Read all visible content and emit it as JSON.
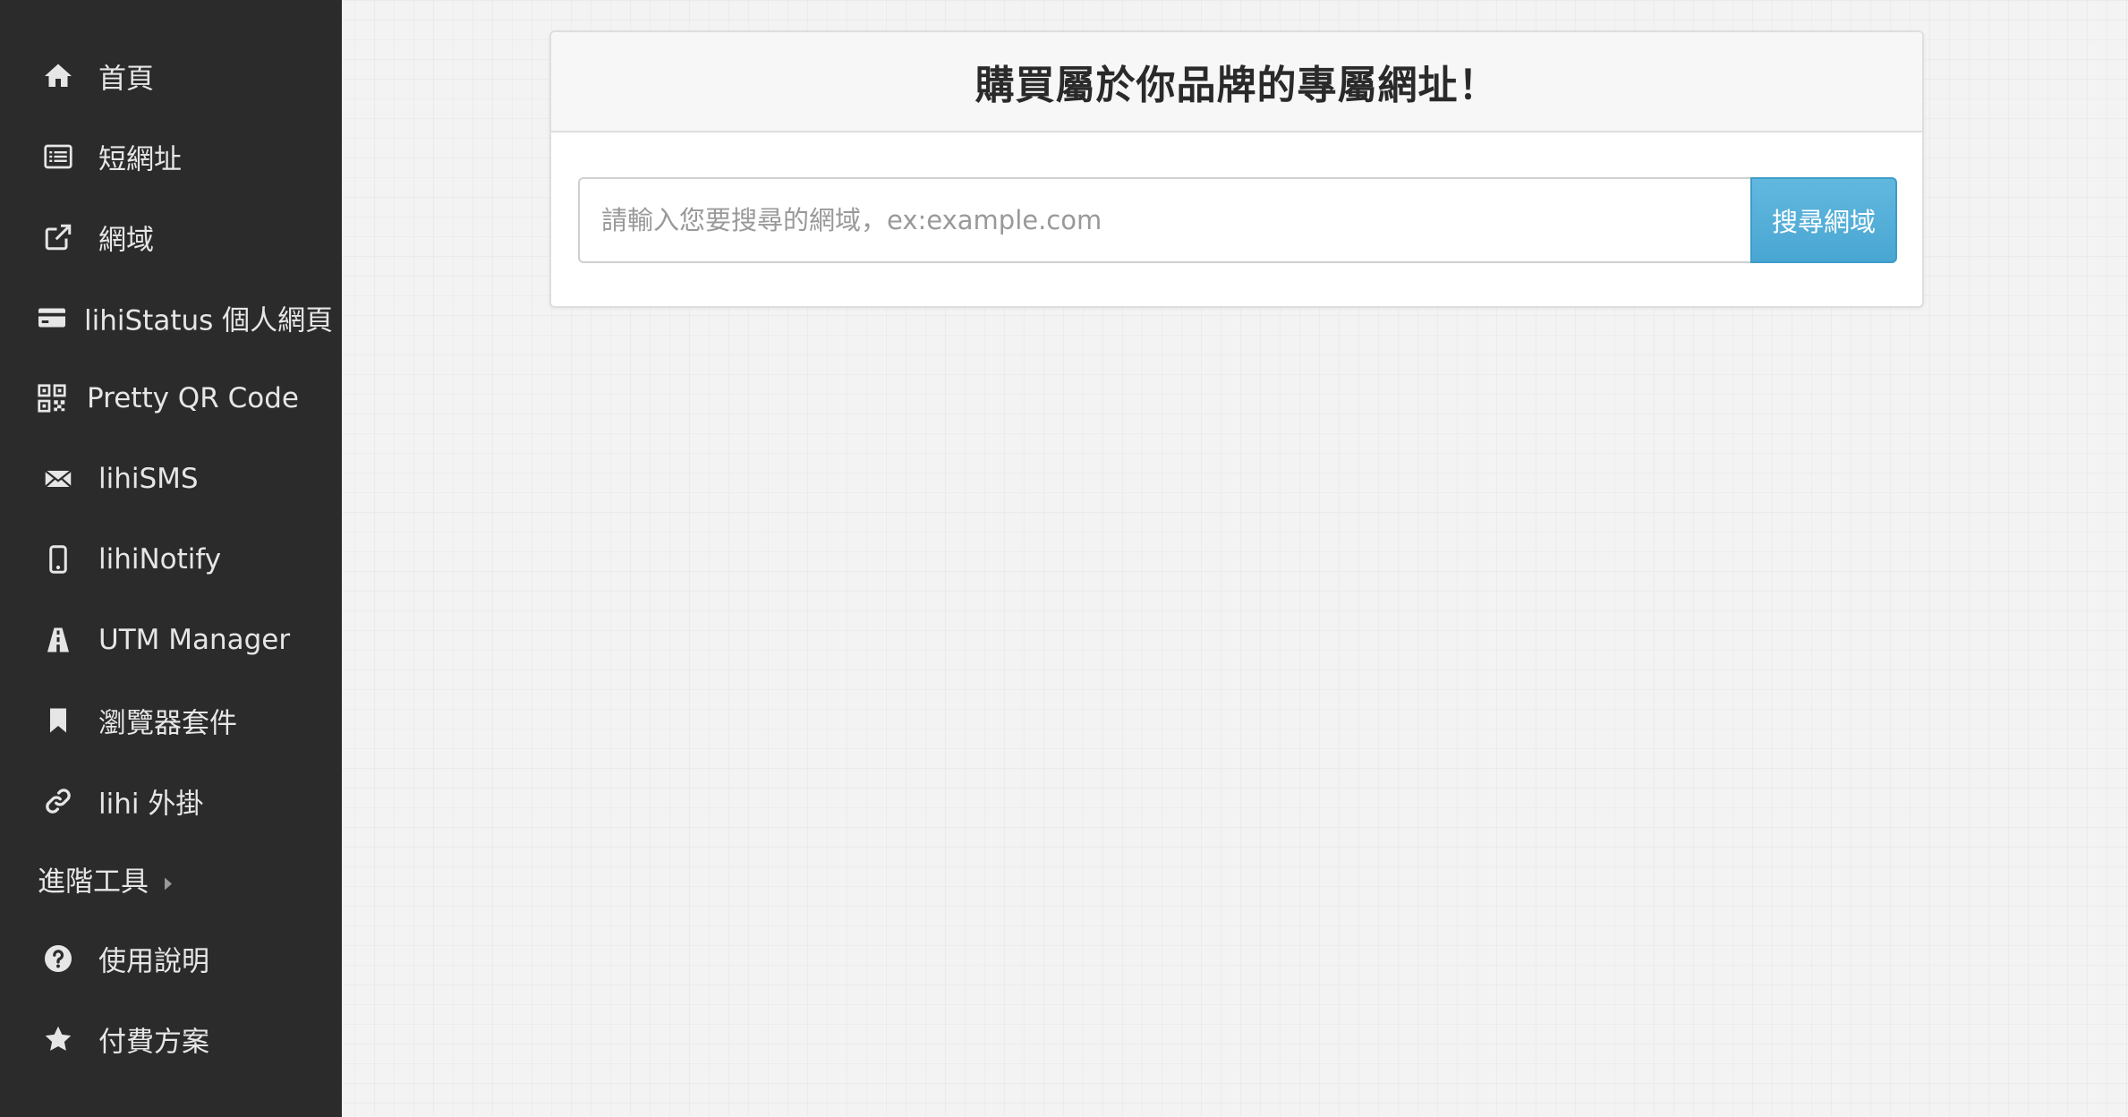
{
  "sidebar": {
    "items": [
      {
        "label": "首頁",
        "icon": "home-icon"
      },
      {
        "label": "短網址",
        "icon": "list-icon"
      },
      {
        "label": "網域",
        "icon": "external-link-icon"
      },
      {
        "label": "lihiStatus 個人網頁",
        "icon": "credit-card-icon"
      },
      {
        "label": "Pretty QR Code",
        "icon": "qrcode-icon"
      },
      {
        "label": "lihiSMS",
        "icon": "envelope-icon"
      },
      {
        "label": "lihiNotify",
        "icon": "mobile-icon"
      },
      {
        "label": "UTM Manager",
        "icon": "road-icon"
      },
      {
        "label": "瀏覽器套件",
        "icon": "bookmark-icon"
      },
      {
        "label": "lihi 外掛",
        "icon": "link-icon"
      },
      {
        "label": "進階工具",
        "icon": "caret-right-icon"
      },
      {
        "label": "使用說明",
        "icon": "question-circle-icon"
      },
      {
        "label": "付費方案",
        "icon": "star-icon"
      }
    ]
  },
  "panel": {
    "title": "購買屬於你品牌的專屬網址！",
    "search_placeholder": "請輸入您要搜尋的網域，ex:example.com",
    "search_value": "",
    "search_button_label": "搜尋網域"
  },
  "colors": {
    "sidebar_bg": "#2b2b2b",
    "sidebar_text": "#e6e6e6",
    "accent_button": "#5bb4dc",
    "page_bg": "#f3f3f3"
  }
}
